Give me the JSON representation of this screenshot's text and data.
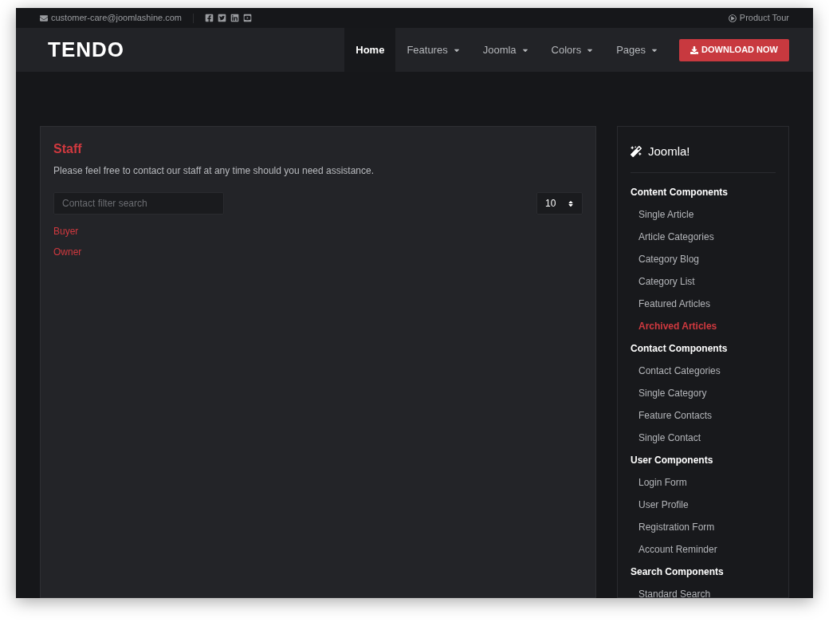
{
  "topbar": {
    "email": "customer-care@joomlashine.com",
    "product_tour": "Product Tour"
  },
  "nav": {
    "logo": "TENDO",
    "items": [
      {
        "label": "Home",
        "selected": true,
        "dropdown": false
      },
      {
        "label": "Features",
        "selected": false,
        "dropdown": true
      },
      {
        "label": "Joomla",
        "selected": false,
        "dropdown": true
      },
      {
        "label": "Colors",
        "selected": false,
        "dropdown": true
      },
      {
        "label": "Pages",
        "selected": false,
        "dropdown": true
      }
    ],
    "cta": "DOWNLOAD NOW"
  },
  "main": {
    "title": "Staff",
    "description": "Please feel free to contact our staff at any time should you need assistance.",
    "search": {
      "placeholder": "Contact filter search"
    },
    "limit": "10",
    "categories": [
      "Buyer",
      "Owner"
    ]
  },
  "sidebar": {
    "title": "Joomla!",
    "groups": [
      {
        "label": "Content Components",
        "items": [
          {
            "label": "Single Article",
            "selected": false
          },
          {
            "label": "Article Categories",
            "selected": false
          },
          {
            "label": "Category Blog",
            "selected": false
          },
          {
            "label": "Category List",
            "selected": false
          },
          {
            "label": "Featured Articles",
            "selected": false
          },
          {
            "label": "Archived Articles",
            "selected": true
          }
        ]
      },
      {
        "label": "Contact Components",
        "items": [
          {
            "label": "Contact Categories",
            "selected": false
          },
          {
            "label": "Single Category",
            "selected": false
          },
          {
            "label": "Feature Contacts",
            "selected": false
          },
          {
            "label": "Single Contact",
            "selected": false
          }
        ]
      },
      {
        "label": "User Components",
        "items": [
          {
            "label": "Login Form",
            "selected": false
          },
          {
            "label": "User Profile",
            "selected": false
          },
          {
            "label": "Registration Form",
            "selected": false
          },
          {
            "label": "Account Reminder",
            "selected": false
          }
        ]
      },
      {
        "label": "Search Components",
        "items": [
          {
            "label": "Standard Search",
            "selected": false
          }
        ]
      }
    ]
  }
}
